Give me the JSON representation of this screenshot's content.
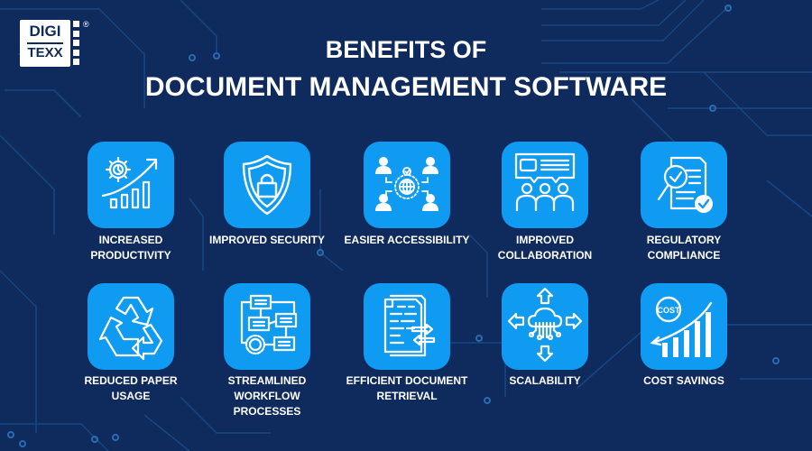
{
  "logo": {
    "line1": "DIGI",
    "line2": "TEXX",
    "registered_mark": "®"
  },
  "header": {
    "title_line1": "BENEFITS OF",
    "title_line2": "DOCUMENT MANAGEMENT SOFTWARE"
  },
  "colors": {
    "background": "#0f2a5c",
    "tile": "#0f9bf2",
    "text": "#ffffff",
    "circuit": "#1c4f8f"
  },
  "benefits": [
    {
      "label_line1": "INCREASED",
      "label_line2": "PRODUCTIVITY",
      "icon": "productivity-chart-icon"
    },
    {
      "label_line1": "IMPROVED SECURITY",
      "label_line2": "",
      "icon": "shield-lock-icon"
    },
    {
      "label_line1": "EASIER ACCESSIBILITY",
      "label_line2": "",
      "icon": "globe-users-icon"
    },
    {
      "label_line1": "IMPROVED",
      "label_line2": "COLLABORATION",
      "icon": "team-chat-icon"
    },
    {
      "label_line1": "REGULATORY",
      "label_line2": "COMPLIANCE",
      "icon": "document-check-icon"
    },
    {
      "label_line1": "REDUCED PAPER",
      "label_line2": "USAGE",
      "icon": "recycle-icon"
    },
    {
      "label_line1": "STREAMLINED",
      "label_line2": "WORKFLOW",
      "label_line3": "PROCESSES",
      "icon": "workflow-icon"
    },
    {
      "label_line1": "EFFICIENT DOCUMENT",
      "label_line2": "RETRIEVAL",
      "icon": "document-transfer-icon"
    },
    {
      "label_line1": "SCALABILITY",
      "label_line2": "",
      "icon": "cloud-scale-icon"
    },
    {
      "label_line1": "COST SAVINGS",
      "label_line2": "",
      "icon": "cost-chart-icon",
      "badge_text": "COST"
    }
  ]
}
